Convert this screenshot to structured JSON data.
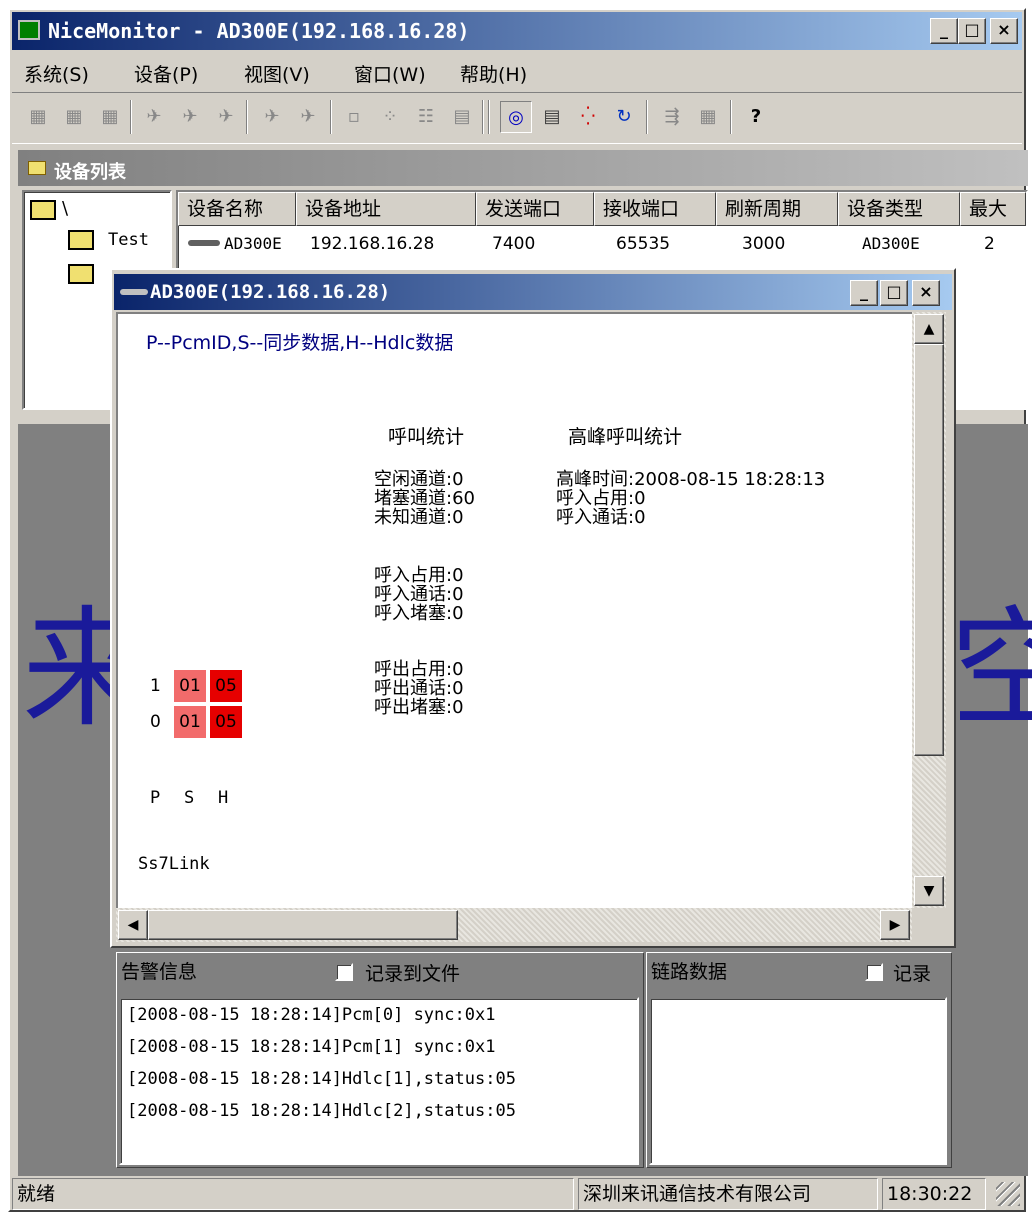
{
  "window": {
    "title": "NiceMonitor - AD300E(192.168.16.28)",
    "minimize": "_",
    "maximize": "□",
    "close": "×"
  },
  "menu": {
    "items": [
      "系统(S)",
      "设备(P)",
      "视图(V)",
      "窗口(W)",
      "帮助(H)"
    ]
  },
  "toolbar": {
    "help_icon": "?"
  },
  "device_list": {
    "header": "设备列表",
    "tree_root": "\\",
    "tree_child": "Test",
    "columns": [
      "设备名称",
      "设备地址",
      "发送端口",
      "接收端口",
      "刷新周期",
      "设备类型",
      "最大"
    ],
    "rows": [
      {
        "name": "AD300E",
        "address": "192.168.16.28",
        "send_port": "7400",
        "recv_port": "65535",
        "refresh": "3000",
        "type": "AD300E",
        "max": "2"
      }
    ]
  },
  "background_text": {
    "left": "来",
    "right": "空"
  },
  "child_window": {
    "title": "AD300E(192.168.16.28)",
    "legend": "P--PcmID,S--同步数据,H--Hdlc数据",
    "call_stats_title": "呼叫统计",
    "peak_stats_title": "高峰呼叫统计",
    "call_stats": {
      "group1": [
        "空闲通道:0",
        "堵塞通道:60",
        "未知通道:0"
      ],
      "group2": [
        "呼入占用:0",
        "呼入通话:0",
        "呼入堵塞:0"
      ],
      "group3": [
        "呼出占用:0",
        "呼出通话:0",
        "呼出堵塞:0"
      ]
    },
    "peak_stats": [
      "高峰时间:2008-08-15 18:28:13",
      "呼入占用:0",
      "呼入通话:0"
    ],
    "pcm_rows": [
      {
        "pcm": "1",
        "sync": "01",
        "hdlc": "05"
      },
      {
        "pcm": "0",
        "sync": "01",
        "hdlc": "05"
      }
    ],
    "pcm_colors": {
      "sync": "#f26b6b",
      "hdlc": "#e60000"
    },
    "pcm_header": {
      "p": "P",
      "s": "S",
      "h": "H"
    },
    "link_label": "Ss7Link"
  },
  "alarm": {
    "title": "告警信息",
    "log_to_file": "记录到文件",
    "lines": [
      "[2008-08-15 18:28:14]Pcm[0] sync:0x1",
      "[2008-08-15 18:28:14]Pcm[1] sync:0x1",
      "[2008-08-15 18:28:14]Hdlc[1],status:05",
      "[2008-08-15 18:28:14]Hdlc[2],status:05"
    ]
  },
  "link_data": {
    "title": "链路数据",
    "log_label": "记录"
  },
  "status": {
    "ready": "就绪",
    "company": "深圳来讯通信技术有限公司",
    "time": "18:30:22"
  }
}
